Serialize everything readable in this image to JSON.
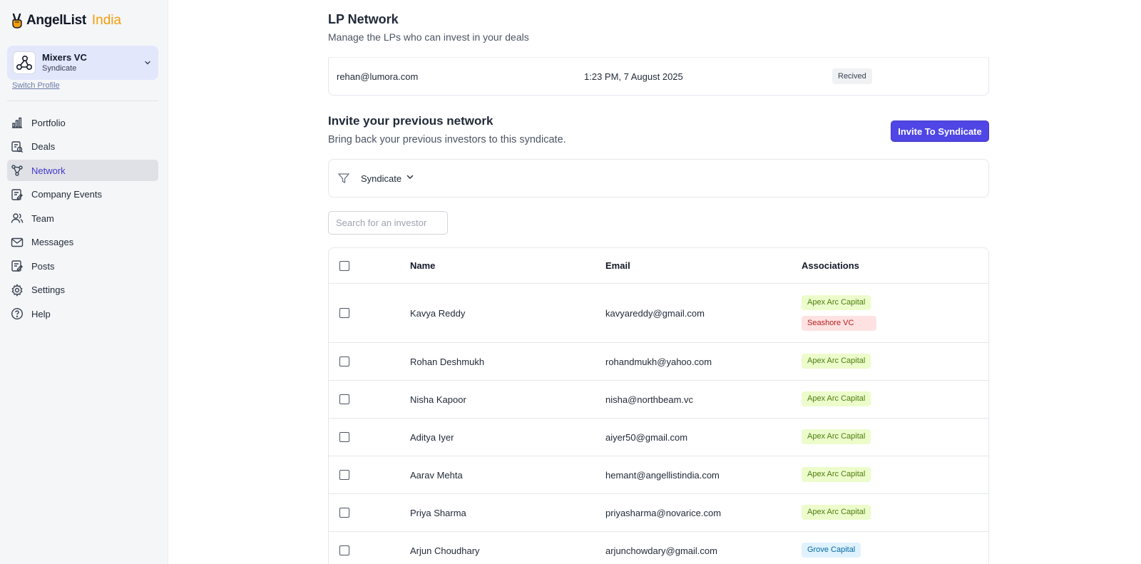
{
  "brand": {
    "name": "AngelList",
    "region": "India"
  },
  "profile": {
    "name": "Mixers VC",
    "type": "Syndicate",
    "switch_label": "Switch Profile"
  },
  "sidebar": {
    "items": [
      {
        "label": "Portfolio",
        "icon": "bar-chart-icon"
      },
      {
        "label": "Deals",
        "icon": "deals-icon"
      },
      {
        "label": "Network",
        "icon": "network-icon",
        "active": true
      },
      {
        "label": "Company Events",
        "icon": "events-icon"
      },
      {
        "label": "Team",
        "icon": "team-icon"
      },
      {
        "label": "Messages",
        "icon": "mail-icon"
      },
      {
        "label": "Posts",
        "icon": "posts-icon"
      },
      {
        "label": "Settings",
        "icon": "gear-icon"
      },
      {
        "label": "Help",
        "icon": "help-icon"
      }
    ]
  },
  "header": {
    "title": "LP Network",
    "subtitle": "Manage the LPs who can invest in your deals"
  },
  "received_invite": {
    "email": "rehan@lumora.com",
    "time": "1:23 PM, 7 August 2025",
    "status": "Recived"
  },
  "invite_section": {
    "title": "Invite your previous network",
    "subtitle": "Bring back your previous investors to this syndicate.",
    "button_label": "Invite To Syndicate"
  },
  "filter": {
    "selected": "Syndicate"
  },
  "search": {
    "placeholder": "Search for an investor"
  },
  "table": {
    "columns": [
      "Name",
      "Email",
      "Associations"
    ],
    "rows": [
      {
        "name": "Kavya Reddy",
        "email": "kavyareddy@gmail.com",
        "associations": [
          "Apex Arc Capital",
          "Seashore VC"
        ]
      },
      {
        "name": "Rohan Deshmukh",
        "email": "rohandmukh@yahoo.com",
        "associations": [
          "Apex Arc Capital"
        ]
      },
      {
        "name": "Nisha Kapoor",
        "email": "nisha@northbeam.vc",
        "associations": [
          "Apex Arc Capital"
        ]
      },
      {
        "name": "Aditya Iyer",
        "email": "aiyer50@gmail.com",
        "associations": [
          "Apex Arc Capital"
        ]
      },
      {
        "name": "Aarav Mehta",
        "email": "hemant@angellistindia.com",
        "associations": [
          "Apex Arc Capital"
        ]
      },
      {
        "name": "Priya Sharma",
        "email": "priyasharma@novarice.com",
        "associations": [
          "Apex Arc Capital"
        ]
      },
      {
        "name": "Arjun Choudhary",
        "email": "arjunchowdary@gmail.com",
        "associations": [
          "Grove Capital"
        ]
      }
    ]
  },
  "colors": {
    "accent": "#4f46e5",
    "active_nav_text": "#4338ca",
    "apex_tag_bg": "#ecfccb",
    "seashore_tag_bg": "#fee2e2",
    "grove_tag_bg": "#e0f2fe"
  }
}
